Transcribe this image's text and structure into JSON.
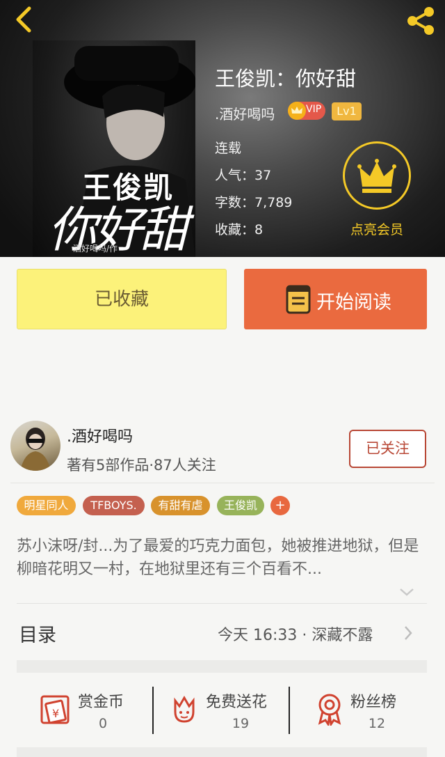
{
  "book": {
    "title": "王俊凯：你好甜",
    "author": ".酒好喝吗",
    "vip_badge": "VIP",
    "level_badge": "Lv1",
    "status": "连载",
    "popularity": "人气：37",
    "word_count": "字数：7,789",
    "favorites": "收藏：8",
    "member_label": "点亮会员",
    "cover": {
      "title_line1": "王俊凯",
      "title_line2": "你好甜",
      "byline": "酒好喝吗/作"
    }
  },
  "actions": {
    "favorited_label": "已收藏",
    "read_label": "开始阅读"
  },
  "author_card": {
    "name": ".酒好喝吗",
    "meta": "著有5部作品·87人关注",
    "follow_label": "已关注"
  },
  "tags": [
    {
      "label": "明星同人",
      "color": "#f0a93c"
    },
    {
      "label": "TFBOYS.",
      "color": "#c4604f"
    },
    {
      "label": "有甜有虐",
      "color": "#d8922c"
    },
    {
      "label": "王俊凯",
      "color": "#97b35a"
    }
  ],
  "tag_add": "+",
  "description": "苏小沫呀/封...为了最爱的巧克力面包，她被推进地狱，但是柳暗花明又一村，在地狱里还有三个百看不...",
  "toc": {
    "label": "目录",
    "latest": "今天 16:33 · 深藏不露"
  },
  "stats": {
    "reward_label": "赏金币",
    "reward_value": "0",
    "flower_label": "免费送花",
    "flower_value": "19",
    "fans_label": "粉丝榜",
    "fans_value": "12"
  },
  "colors": {
    "accent_orange": "#ea6a3f",
    "accent_yellow": "#fcf27a",
    "gold": "#f4c927",
    "icon_red": "#d0422f"
  }
}
